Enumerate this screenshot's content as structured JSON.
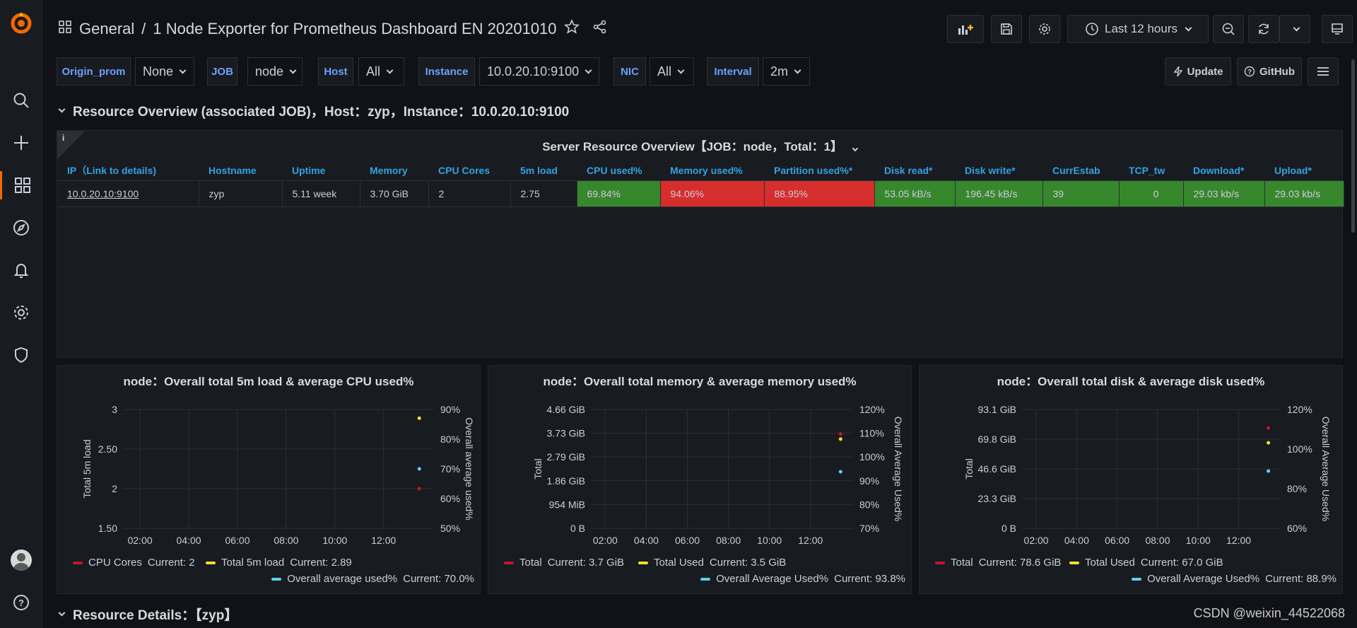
{
  "app": {
    "name": "Grafana"
  },
  "breadcrumb": {
    "folder": "General",
    "separator": "/",
    "dashboard": "1 Node Exporter for Prometheus Dashboard EN 20201010"
  },
  "toolbar": {
    "time_range": "Last 12 hours"
  },
  "variables": [
    {
      "label": "Origin_prom",
      "value": "None"
    },
    {
      "label": "JOB",
      "value": "node"
    },
    {
      "label": "Host",
      "value": "All"
    },
    {
      "label": "Instance",
      "value": "10.0.20.10:9100"
    },
    {
      "label": "NIC",
      "value": "All"
    },
    {
      "label": "Interval",
      "value": "2m"
    }
  ],
  "links": {
    "update": "Update",
    "github": "GitHub"
  },
  "rows": {
    "overview": "Resource Overview (associated JOB)，Host：zyp，Instance：10.0.20.10:9100",
    "details": "Resource Details：【zyp】"
  },
  "table_panel": {
    "title": "Server Resource Overview【JOB：node，Total：1】",
    "info": "i",
    "columns": [
      "IP（Link to details)",
      "Hostname",
      "Uptime",
      "Memory",
      "CPU Cores",
      "5m load",
      "CPU used%",
      "Memory used%",
      "Partition used%*",
      "Disk read*",
      "Disk write*",
      "CurrEstab",
      "TCP_tw",
      "Download*",
      "Upload*"
    ],
    "rows": [
      [
        "10.0.20.10:9100",
        "zyp",
        "5.11 week",
        "3.70 GiB",
        "2",
        "2.75",
        "69.84%",
        "94.06%",
        "88.95%",
        "53.05 kB/s",
        "196.45 kB/s",
        "39",
        "0",
        "29.03 kb/s",
        "29.03 kb/s"
      ]
    ]
  },
  "colors": {
    "ok": "#37872d",
    "bad": "#d62d2d",
    "red": "#c4162a",
    "yellow": "#fade2a",
    "blue": "#5cd2f0",
    "accent": "#f46800"
  },
  "charts": {
    "load": {
      "title": "node：Overall total 5m load & average CPU used%",
      "y_left_ticks": [
        "3",
        "2.50",
        "2",
        "1.50"
      ],
      "y_right_ticks": [
        "90%",
        "80%",
        "70%",
        "60%",
        "50%"
      ],
      "x_ticks": [
        "02:00",
        "04:00",
        "06:00",
        "08:00",
        "10:00",
        "12:00"
      ],
      "y_left_label": "Total 5m load",
      "y_right_label": "Overall average used%",
      "legend": [
        {
          "name": "CPU Cores",
          "current": "Current: 2",
          "color": "red"
        },
        {
          "name": "Total 5m load",
          "current": "Current: 2.89",
          "color": "yellow"
        },
        {
          "name": "Overall average used%",
          "current": "Current: 70.0%",
          "color": "blue"
        }
      ]
    },
    "memory": {
      "title": "node：Overall total memory & average memory used%",
      "y_left_ticks": [
        "4.66 GiB",
        "3.73 GiB",
        "2.79 GiB",
        "1.86 GiB",
        "954 MiB",
        "0 B"
      ],
      "y_right_ticks": [
        "120%",
        "110%",
        "100%",
        "90%",
        "80%",
        "70%"
      ],
      "x_ticks": [
        "02:00",
        "04:00",
        "06:00",
        "08:00",
        "10:00",
        "12:00"
      ],
      "y_left_label": "Total",
      "y_right_label": "Overall Average Used%",
      "legend": [
        {
          "name": "Total",
          "current": "Current: 3.7 GiB",
          "color": "red"
        },
        {
          "name": "Total Used",
          "current": "Current: 3.5 GiB",
          "color": "yellow"
        },
        {
          "name": "Overall Average Used%",
          "current": "Current: 93.8%",
          "color": "blue"
        }
      ]
    },
    "disk": {
      "title": "node：Overall total disk & average disk used%",
      "y_left_ticks": [
        "93.1 GiB",
        "69.8 GiB",
        "46.6 GiB",
        "23.3 GiB",
        "0 B"
      ],
      "y_right_ticks": [
        "120%",
        "100%",
        "80%",
        "60%"
      ],
      "x_ticks": [
        "02:00",
        "04:00",
        "06:00",
        "08:00",
        "10:00",
        "12:00"
      ],
      "y_left_label": "Total",
      "y_right_label": "Overall Average Used%",
      "legend": [
        {
          "name": "Total",
          "current": "Current: 78.6 GiB",
          "color": "red"
        },
        {
          "name": "Total Used",
          "current": "Current: 67.0 GiB",
          "color": "yellow"
        },
        {
          "name": "Overall Average Used%",
          "current": "Current: 88.9%",
          "color": "blue"
        }
      ]
    }
  },
  "chart_data": [
    {
      "type": "scatter",
      "title": "node：Overall total 5m load & average CPU used%",
      "ylabel": "Total 5m load",
      "ylabel_right": "Overall average used%",
      "x": [
        "12:25"
      ],
      "series": [
        {
          "name": "CPU Cores",
          "axis": "left",
          "values": [
            2
          ]
        },
        {
          "name": "Total 5m load",
          "axis": "left",
          "values": [
            2.89
          ]
        },
        {
          "name": "Overall average used%",
          "axis": "right",
          "values": [
            70.0
          ]
        }
      ],
      "ylim": [
        1.5,
        3
      ],
      "ylim_right": [
        50,
        90
      ]
    },
    {
      "type": "scatter",
      "title": "node：Overall total memory & average memory used%",
      "ylabel": "Total",
      "ylabel_right": "Overall Average Used%",
      "x": [
        "12:25"
      ],
      "series": [
        {
          "name": "Total",
          "axis": "left",
          "values": [
            3.7
          ]
        },
        {
          "name": "Total Used",
          "axis": "left",
          "values": [
            3.5
          ]
        },
        {
          "name": "Overall Average Used%",
          "axis": "right",
          "values": [
            93.8
          ]
        }
      ],
      "ylim": [
        0,
        4.66
      ],
      "ylim_right": [
        70,
        120
      ]
    },
    {
      "type": "scatter",
      "title": "node：Overall total disk & average disk used%",
      "ylabel": "Total",
      "ylabel_right": "Overall Average Used%",
      "x": [
        "12:25"
      ],
      "series": [
        {
          "name": "Total",
          "axis": "left",
          "values": [
            78.6
          ]
        },
        {
          "name": "Total Used",
          "axis": "left",
          "values": [
            67.0
          ]
        },
        {
          "name": "Overall Average Used%",
          "axis": "right",
          "values": [
            88.9
          ]
        }
      ],
      "ylim": [
        0,
        93.1
      ],
      "ylim_right": [
        60,
        120
      ]
    }
  ],
  "watermark": "CSDN @weixin_44522068"
}
